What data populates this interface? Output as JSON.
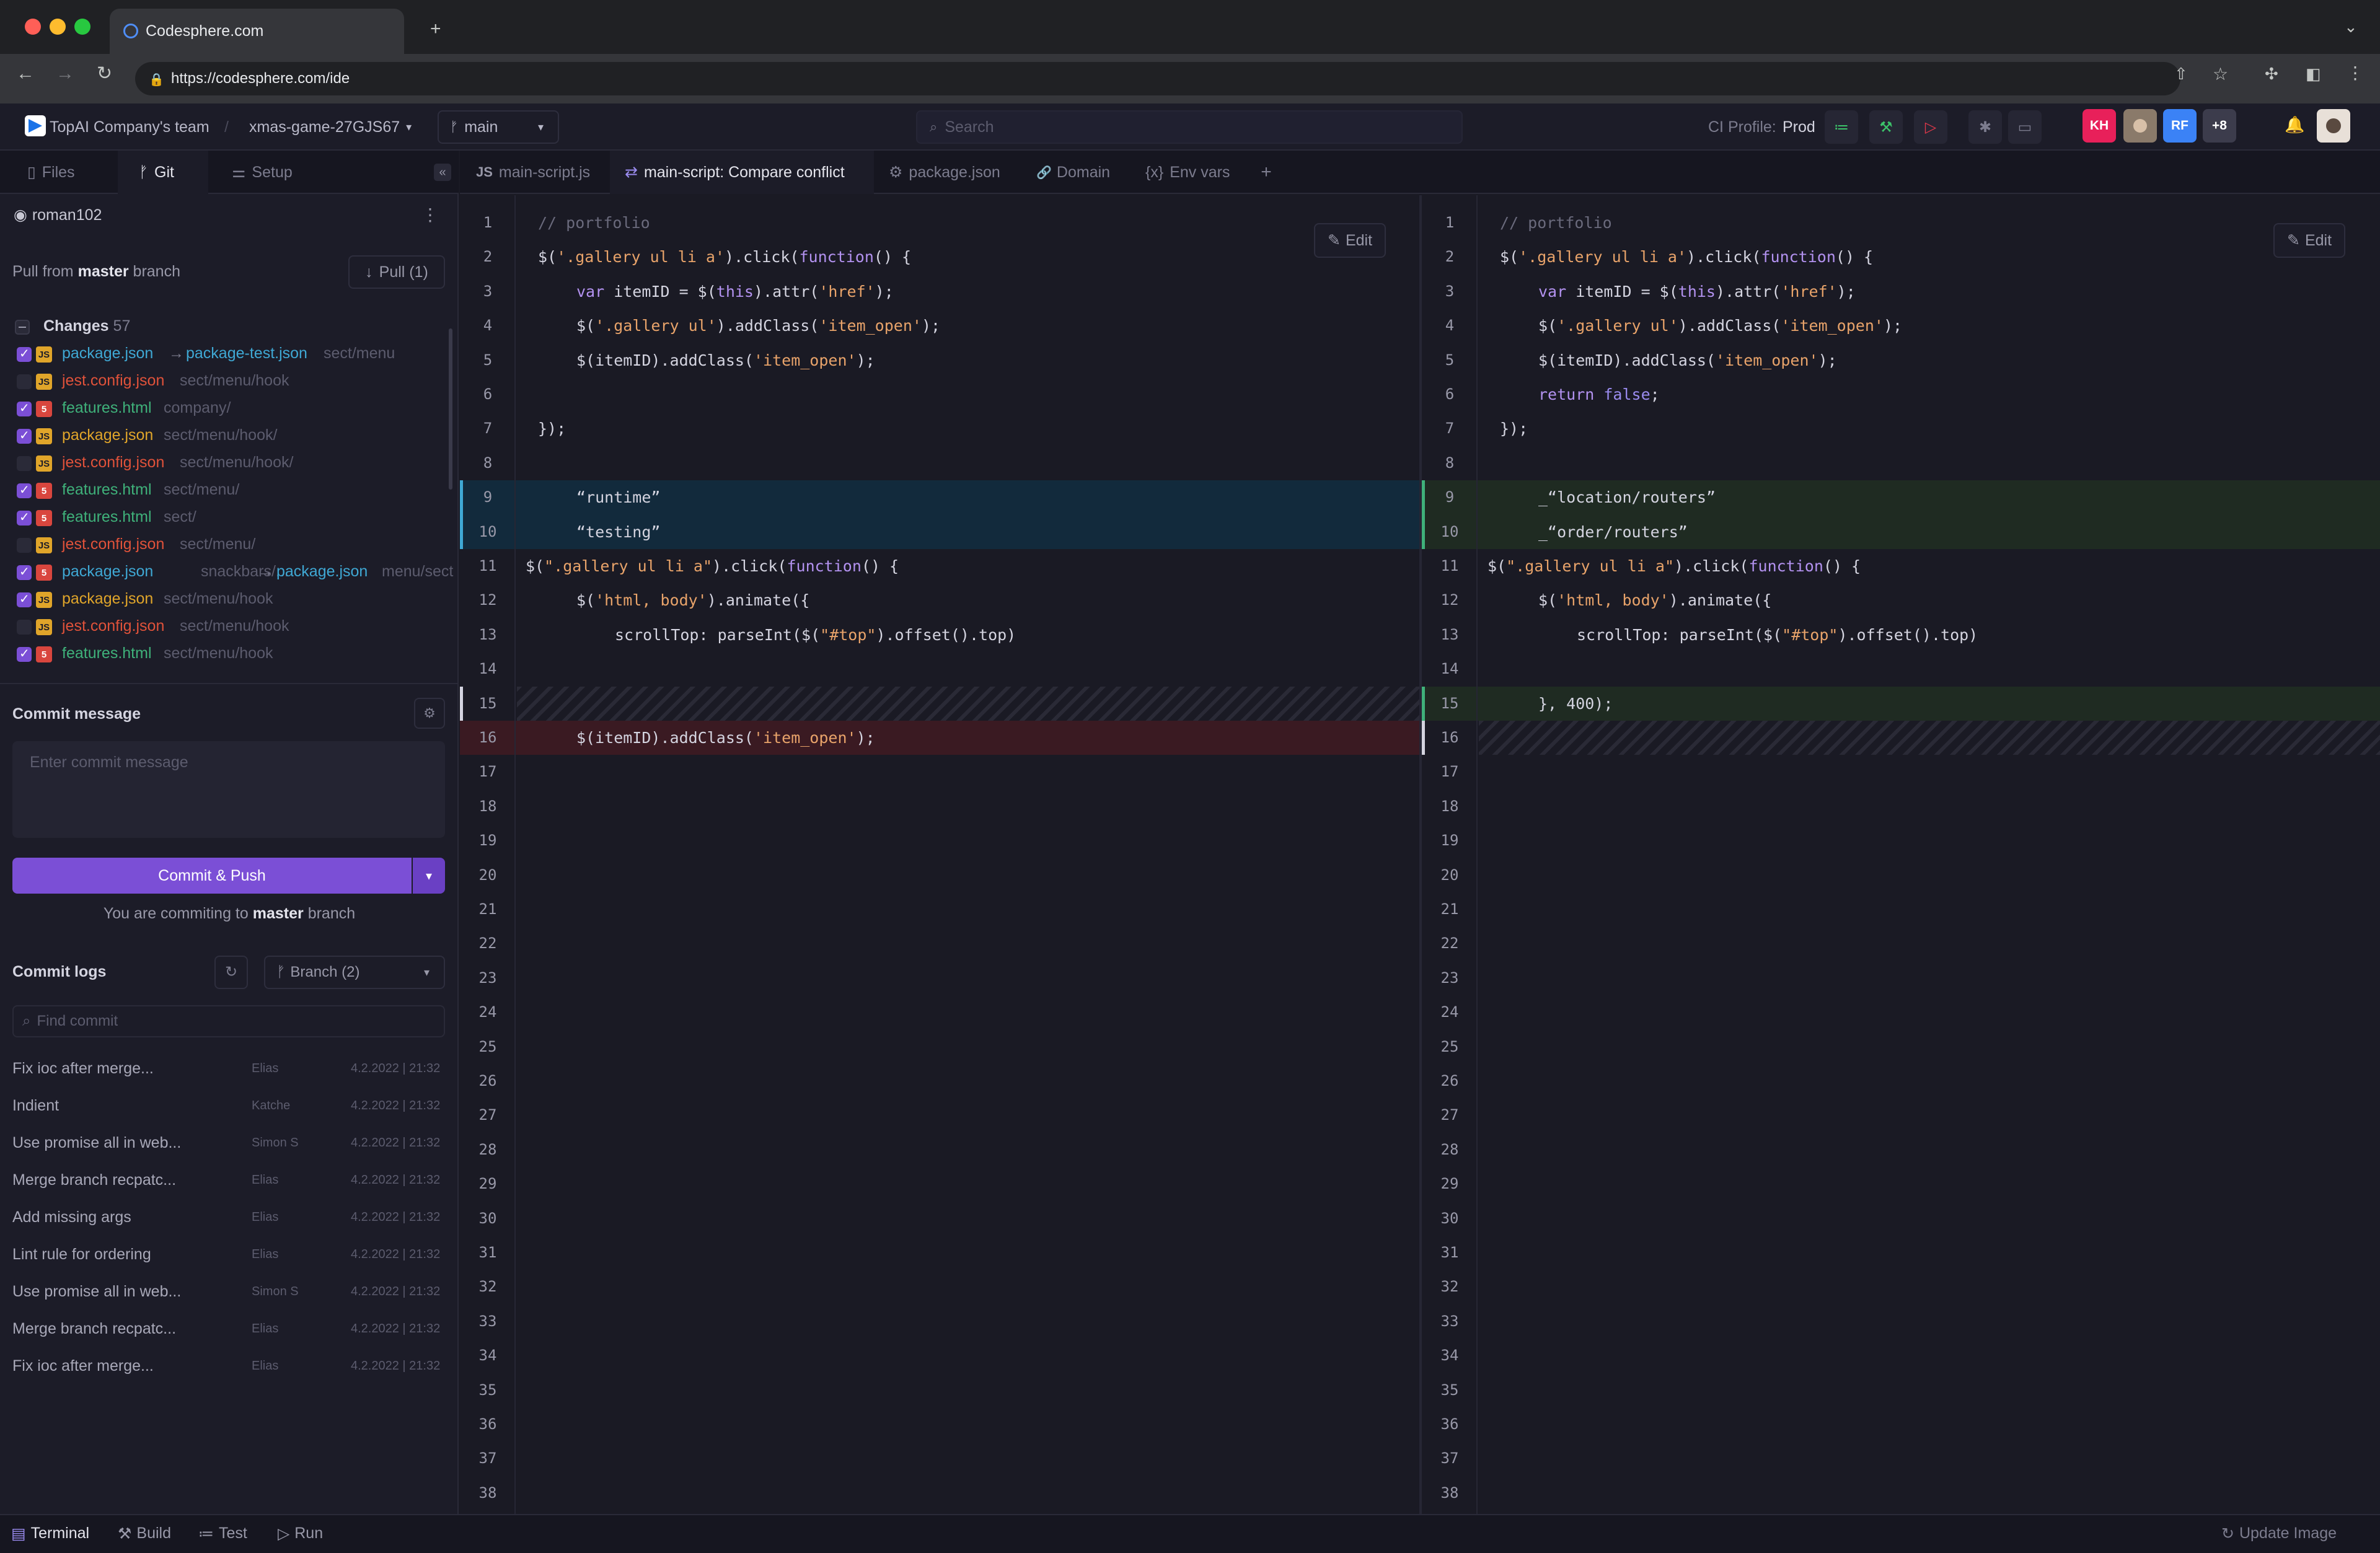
{
  "browser": {
    "tab_title": "Codesphere.com",
    "url": "https://codesphere.com/ide"
  },
  "header": {
    "team": "TopAI Company's team",
    "workspace": "xmas-game-27GJS67",
    "branch": "main",
    "search_placeholder": "Search",
    "ci_label": "CI Profile:",
    "ci_value": "Prod",
    "avatars": [
      {
        "initials": "KH",
        "color": "#e8205a"
      },
      {
        "initials": "RF",
        "color": "#3b82f6"
      },
      {
        "initials": "+8",
        "color": "#3c3c4c"
      }
    ]
  },
  "sidebar": {
    "tabs": [
      "Files",
      "Git",
      "Setup"
    ],
    "user": "roman102",
    "pull_text_pre": "Pull from",
    "pull_branch": "master",
    "pull_text_post": "branch",
    "pull_button": "Pull",
    "pull_count": "(1)",
    "changes_label": "Changes",
    "changes_count": "57",
    "changes": [
      {
        "checked": true,
        "type": "JS",
        "name": "package.json",
        "arrow_to": "package-test.json",
        "path": "sect/menu"
      },
      {
        "checked": false,
        "type": "JS",
        "name": "jest.config.json",
        "path": "sect/menu/hook"
      },
      {
        "checked": true,
        "type": "HTML",
        "name": "features.html",
        "path": "company/"
      },
      {
        "checked": true,
        "type": "JS",
        "name": "package.json",
        "path": "sect/menu/hook/"
      },
      {
        "checked": false,
        "type": "JS",
        "name": "jest.config.json",
        "path": "sect/menu/hook/"
      },
      {
        "checked": true,
        "type": "HTML",
        "name": "features.html",
        "path": "sect/menu/"
      },
      {
        "checked": true,
        "type": "HTML",
        "name": "features.html",
        "path": "sect/"
      },
      {
        "checked": false,
        "type": "JS",
        "name": "jest.config.json",
        "path": "sect/menu/"
      },
      {
        "checked": true,
        "type": "HTML",
        "name": "package.json",
        "path": "snackbars/...",
        "arrow_to": "package.json",
        "path2": "menu/sect"
      },
      {
        "checked": true,
        "type": "JS",
        "name": "package.json",
        "path": "sect/menu/hook"
      },
      {
        "checked": false,
        "type": "JS",
        "name": "jest.config.json",
        "path": "sect/menu/hook"
      },
      {
        "checked": true,
        "type": "HTML",
        "name": "features.html",
        "path": "sect/menu/hook"
      }
    ],
    "commit_label": "Commit message",
    "commit_placeholder": "Enter commit message",
    "commit_button": "Commit & Push",
    "commit_to_pre": "You are commiting to",
    "commit_to_branch": "master",
    "commit_to_post": "branch",
    "logs_label": "Commit logs",
    "branch_select": "Branch (2)",
    "find_placeholder": "Find commit",
    "logs": [
      {
        "msg": "Fix ioc after merge...",
        "author": "Elias",
        "date": "4.2.2022 | 21:32"
      },
      {
        "msg": "Indient",
        "author": "Katche",
        "date": "4.2.2022 | 21:32"
      },
      {
        "msg": "Use promise all in web...",
        "author": "Simon S",
        "date": "4.2.2022 | 21:32"
      },
      {
        "msg": "Merge branch recpatc...",
        "author": "Elias",
        "date": "4.2.2022 | 21:32"
      },
      {
        "msg": "Add missing args",
        "author": "Elias",
        "date": "4.2.2022 | 21:32"
      },
      {
        "msg": "Lint rule for ordering",
        "author": "Elias",
        "date": "4.2.2022 | 21:32"
      },
      {
        "msg": "Use promise all in web...",
        "author": "Simon S",
        "date": "4.2.2022 | 21:32"
      },
      {
        "msg": "Merge branch recpatc...",
        "author": "Elias",
        "date": "4.2.2022 | 21:32"
      },
      {
        "msg": "Fix ioc after merge...",
        "author": "Elias",
        "date": "4.2.2022 | 21:32"
      }
    ]
  },
  "editor": {
    "tabs": [
      {
        "icon": "JS",
        "label": "main-script.js"
      },
      {
        "icon": "⇄",
        "label": "main-script: Compare conflict"
      },
      {
        "icon": "⚙",
        "label": "package.json"
      },
      {
        "icon": "🔗",
        "label": "Domain"
      },
      {
        "icon": "{x}",
        "label": "Env vars"
      }
    ],
    "edit_label": "Edit",
    "line_count": 38,
    "left": [
      {
        "line": 1,
        "indent": 0,
        "tokens": [
          [
            "cm",
            "// portfolio"
          ]
        ]
      },
      {
        "line": 2,
        "indent": 0,
        "tokens": [
          [
            "p",
            "$("
          ],
          [
            "s",
            "'.gallery ul li a'"
          ],
          [
            "p",
            ").click("
          ],
          [
            "kw",
            "function"
          ],
          [
            "p",
            "() {"
          ]
        ]
      },
      {
        "line": 3,
        "indent": 1,
        "tokens": [
          [
            "kw",
            "var"
          ],
          [
            "p",
            " itemID = $("
          ],
          [
            "kw",
            "this"
          ],
          [
            "p",
            ").attr("
          ],
          [
            "s",
            "'href'"
          ],
          [
            "p",
            ");"
          ]
        ]
      },
      {
        "line": 4,
        "indent": 1,
        "tokens": [
          [
            "p",
            "$("
          ],
          [
            "s",
            "'.gallery ul'"
          ],
          [
            "p",
            ").addClass("
          ],
          [
            "s",
            "'item_open'"
          ],
          [
            "p",
            ");"
          ]
        ]
      },
      {
        "line": 5,
        "indent": 1,
        "tokens": [
          [
            "p",
            "$(itemID).addClass("
          ],
          [
            "s",
            "'item_open'"
          ],
          [
            "p",
            ");"
          ]
        ]
      },
      {
        "line": 7,
        "indent": 0,
        "tokens": [
          [
            "p",
            "});"
          ]
        ]
      },
      {
        "line": 9,
        "indent": 1,
        "tokens": [
          [
            "p",
            "“runtime”"
          ]
        ]
      },
      {
        "line": 10,
        "indent": 1,
        "tokens": [
          [
            "p",
            "“testing”"
          ]
        ]
      },
      {
        "line": 11,
        "indent": -1,
        "tokens": [
          [
            "p",
            "$("
          ],
          [
            "s",
            "\".gallery ul li a\""
          ],
          [
            "p",
            ").click("
          ],
          [
            "kw",
            "function"
          ],
          [
            "p",
            "() {"
          ]
        ]
      },
      {
        "line": 12,
        "indent": 1,
        "tokens": [
          [
            "p",
            "$("
          ],
          [
            "s",
            "'html, body'"
          ],
          [
            "p",
            ").animate({"
          ]
        ]
      },
      {
        "line": 13,
        "indent": 2,
        "tokens": [
          [
            "p",
            "scrollTop: parseInt($("
          ],
          [
            "s",
            "\"#top\""
          ],
          [
            "p",
            ").offset().top)"
          ]
        ]
      },
      {
        "line": 16,
        "indent": 1,
        "tokens": [
          [
            "p",
            "$(itemID).addClass("
          ],
          [
            "s",
            "'item_open'"
          ],
          [
            "p",
            ");"
          ]
        ]
      }
    ],
    "right": [
      {
        "line": 1,
        "indent": 0,
        "tokens": [
          [
            "cm",
            "// portfolio"
          ]
        ]
      },
      {
        "line": 2,
        "indent": 0,
        "tokens": [
          [
            "p",
            "$("
          ],
          [
            "s",
            "'.gallery ul li a'"
          ],
          [
            "p",
            ").click("
          ],
          [
            "kw",
            "function"
          ],
          [
            "p",
            "() {"
          ]
        ]
      },
      {
        "line": 3,
        "indent": 1,
        "tokens": [
          [
            "kw",
            "var"
          ],
          [
            "p",
            " itemID = $("
          ],
          [
            "kw",
            "this"
          ],
          [
            "p",
            ").attr("
          ],
          [
            "s",
            "'href'"
          ],
          [
            "p",
            ");"
          ]
        ]
      },
      {
        "line": 4,
        "indent": 1,
        "tokens": [
          [
            "p",
            "$("
          ],
          [
            "s",
            "'.gallery ul'"
          ],
          [
            "p",
            ").addClass("
          ],
          [
            "s",
            "'item_open'"
          ],
          [
            "p",
            ");"
          ]
        ]
      },
      {
        "line": 5,
        "indent": 1,
        "tokens": [
          [
            "p",
            "$(itemID).addClass("
          ],
          [
            "s",
            "'item_open'"
          ],
          [
            "p",
            ");"
          ]
        ]
      },
      {
        "line": 6,
        "indent": 1,
        "tokens": [
          [
            "kw",
            "return"
          ],
          [
            "p",
            " "
          ],
          [
            "f",
            "false"
          ],
          [
            "p",
            ";"
          ]
        ]
      },
      {
        "line": 7,
        "indent": 0,
        "tokens": [
          [
            "p",
            "});"
          ]
        ]
      },
      {
        "line": 9,
        "indent": 1,
        "tokens": [
          [
            "p",
            "_“location/routers”"
          ]
        ]
      },
      {
        "line": 10,
        "indent": 1,
        "tokens": [
          [
            "p",
            "_“order/routers”"
          ]
        ]
      },
      {
        "line": 11,
        "indent": -1,
        "tokens": [
          [
            "p",
            "$("
          ],
          [
            "s",
            "\".gallery ul li a\""
          ],
          [
            "p",
            ").click("
          ],
          [
            "kw",
            "function"
          ],
          [
            "p",
            "() {"
          ]
        ]
      },
      {
        "line": 12,
        "indent": 1,
        "tokens": [
          [
            "p",
            "$("
          ],
          [
            "s",
            "'html, body'"
          ],
          [
            "p",
            ").animate({"
          ]
        ]
      },
      {
        "line": 13,
        "indent": 2,
        "tokens": [
          [
            "p",
            "scrollTop: parseInt($("
          ],
          [
            "s",
            "\"#top\""
          ],
          [
            "p",
            ").offset().top)"
          ]
        ]
      },
      {
        "line": 15,
        "indent": 1,
        "tokens": [
          [
            "p",
            "}, 400);"
          ]
        ]
      }
    ]
  },
  "bottom": {
    "tabs": [
      "Terminal",
      "Build",
      "Test",
      "Run"
    ],
    "update": "Update Image"
  }
}
